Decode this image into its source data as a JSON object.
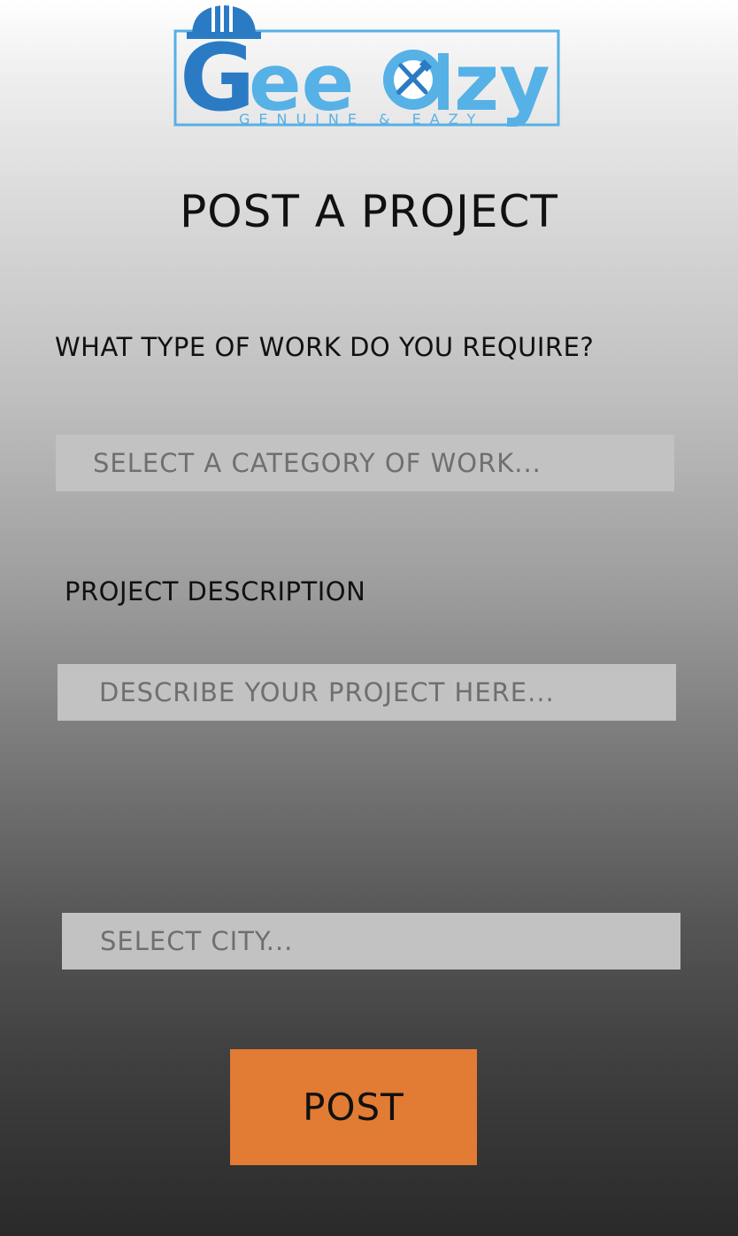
{
  "logo": {
    "wordmark": "Geeazy",
    "tagline": "GENUINE & EAZY"
  },
  "page": {
    "title": "POST A PROJECT"
  },
  "form": {
    "work_type_label": "WHAT TYPE OF WORK DO YOU REQUIRE?",
    "category_placeholder": "SELECT A CATEGORY OF WORK...",
    "description_label": "PROJECT DESCRIPTION",
    "description_placeholder": "DESCRIBE YOUR PROJECT HERE...",
    "city_placeholder": "SELECT CITY...",
    "submit_label": "POST"
  },
  "colors": {
    "accent": "#e27b33",
    "field_bg": "#c2c2c2",
    "logo_blue_dark": "#2a7bc4",
    "logo_blue_light": "#56b1e6"
  }
}
